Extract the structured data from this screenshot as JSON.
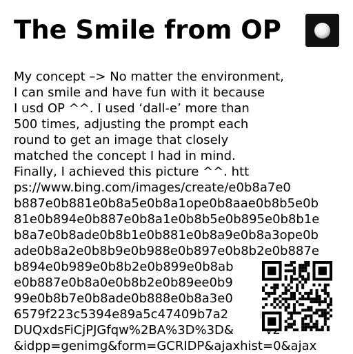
{
  "title": "The Smile from OP",
  "lines": [
    "My concept –> No matter the environment,",
    "I can smile and have fun with it because",
    "I usd OP ^^. I used ‘dall-e’ more than",
    "500 times, adjusting the prompt each",
    "round to get an image that closely",
    "matched the concept I had in mind.",
    "Finally, I achieved this picture ^^. htt",
    "ps://www.bing.com/images/create/e0b8a7e0",
    "b887e0b881e0b8a5e0b8a1ope0b8aae0b8b5e0b",
    "81e0b894e0b887e0b8a1e0b8b5e0b895e0b8b1e",
    "b8a7e0b8ade0b8b1e0b881e0b8a9e0b8a3ope0b",
    "ade0b8a2e0b8b9e0b988e0b897e0b8b2e0b887e",
    "b894e0b989e0b8b2e0b899e0b8ab        3b",
    "e0b887e0b8a0e0b8b2e0b89ee0b9        0b",
    "99e0b8b7e0b8ade0b888e0b8a3e0",
    "6579f223c5394e89a5c47409b7a2        n",
    "DUQxdsFiCjPJGfqw%2BA%3D%3D&        v2",
    "&idpp=genimg&form=GCRIDP&ajaxhist=0&ajax"
  ]
}
